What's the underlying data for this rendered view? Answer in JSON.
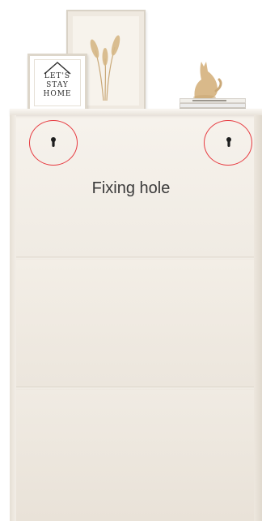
{
  "caption": "Fixing hole",
  "art_print": {
    "text_line_1": "LET'S",
    "text_line_2": "STAY",
    "text_line_3": "HOME"
  },
  "icons": {
    "left_hole": "keyhole-icon",
    "right_hole": "keyhole-icon"
  },
  "colors": {
    "highlight_ring": "#e7393f",
    "cabinet": "#efe9e1",
    "caption": "#3a3a3a"
  }
}
